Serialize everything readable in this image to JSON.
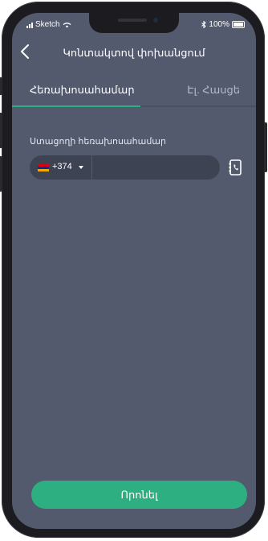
{
  "status_bar": {
    "carrier": "Sketch",
    "battery": "100%"
  },
  "header": {
    "title": "Կոնտակտով փոխանցում"
  },
  "tabs": [
    {
      "label": "Հեռախոսահամար",
      "active": true
    },
    {
      "label": "Էլ. Հասցե",
      "active": false
    }
  ],
  "form": {
    "field_label": "Ստացողի հեռախոսահամար",
    "country_code": "+374",
    "phone_value": "",
    "flag_colors": [
      "#d90012",
      "#0033a0",
      "#f2a800"
    ]
  },
  "search_button": {
    "label": "Որոնել"
  },
  "colors": {
    "accent": "#2daf82",
    "background": "#545a6e",
    "field_bg": "#3e4354"
  }
}
